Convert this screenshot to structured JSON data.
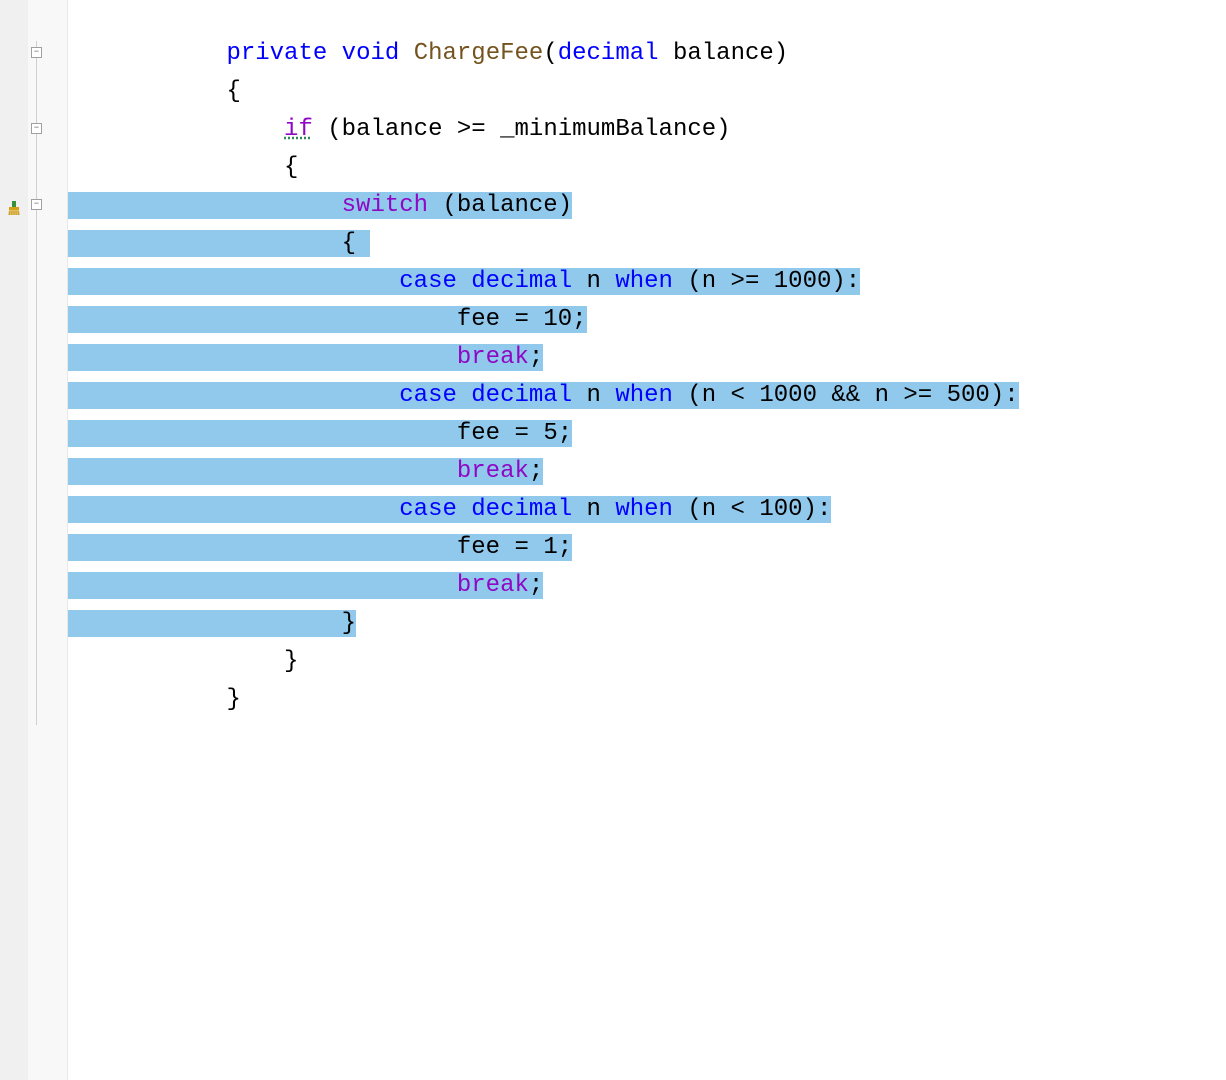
{
  "editor": {
    "lines": [
      {
        "indent": 2,
        "tokens": [
          {
            "t": "private",
            "c": "kw"
          },
          {
            "t": " ",
            "c": "op"
          },
          {
            "t": "void",
            "c": "kw"
          },
          {
            "t": " ",
            "c": "op"
          },
          {
            "t": "ChargeFee",
            "c": "method"
          },
          {
            "t": "(",
            "c": "op"
          },
          {
            "t": "decimal",
            "c": "kw"
          },
          {
            "t": " ",
            "c": "op"
          },
          {
            "t": "balance",
            "c": "ident"
          },
          {
            "t": ")",
            "c": "op"
          }
        ],
        "sel": false
      },
      {
        "indent": 2,
        "tokens": [
          {
            "t": "{",
            "c": "op"
          }
        ],
        "sel": false
      },
      {
        "indent": 3,
        "tokens": [
          {
            "t": "if",
            "c": "ctrl if-underline"
          },
          {
            "t": " (",
            "c": "op"
          },
          {
            "t": "balance",
            "c": "ident"
          },
          {
            "t": " >= ",
            "c": "op"
          },
          {
            "t": "_minimumBalance",
            "c": "ident"
          },
          {
            "t": ")",
            "c": "op"
          }
        ],
        "sel": false
      },
      {
        "indent": 3,
        "tokens": [
          {
            "t": "{",
            "c": "op"
          }
        ],
        "sel": false
      },
      {
        "indent": 4,
        "tokens": [
          {
            "t": "switch",
            "c": "ctrl"
          },
          {
            "t": " (",
            "c": "op"
          },
          {
            "t": "balance",
            "c": "ident"
          },
          {
            "t": ")",
            "c": "op"
          }
        ],
        "sel": true,
        "selFrom": 0
      },
      {
        "indent": 4,
        "tokens": [
          {
            "t": "{",
            "c": "op"
          },
          {
            "t": " ",
            "c": "op"
          }
        ],
        "sel": true,
        "selFrom": 0
      },
      {
        "indent": 5,
        "tokens": [
          {
            "t": "case",
            "c": "kw"
          },
          {
            "t": " ",
            "c": "op"
          },
          {
            "t": "decimal",
            "c": "kw"
          },
          {
            "t": " ",
            "c": "op"
          },
          {
            "t": "n",
            "c": "ident"
          },
          {
            "t": " ",
            "c": "op"
          },
          {
            "t": "when",
            "c": "kw"
          },
          {
            "t": " (",
            "c": "op"
          },
          {
            "t": "n",
            "c": "ident"
          },
          {
            "t": " >= ",
            "c": "op"
          },
          {
            "t": "1000",
            "c": "num"
          },
          {
            "t": "):",
            "c": "op"
          }
        ],
        "sel": true,
        "selFrom": 0
      },
      {
        "indent": 6,
        "tokens": [
          {
            "t": "fee",
            "c": "ident"
          },
          {
            "t": " = ",
            "c": "op"
          },
          {
            "t": "10",
            "c": "num"
          },
          {
            "t": ";",
            "c": "op"
          }
        ],
        "sel": true,
        "selFrom": 0
      },
      {
        "indent": 6,
        "tokens": [
          {
            "t": "break",
            "c": "ctrl"
          },
          {
            "t": ";",
            "c": "op"
          }
        ],
        "sel": true,
        "selFrom": 0
      },
      {
        "indent": 5,
        "tokens": [
          {
            "t": "case",
            "c": "kw"
          },
          {
            "t": " ",
            "c": "op"
          },
          {
            "t": "decimal",
            "c": "kw"
          },
          {
            "t": " ",
            "c": "op"
          },
          {
            "t": "n",
            "c": "ident"
          },
          {
            "t": " ",
            "c": "op"
          },
          {
            "t": "when",
            "c": "kw"
          },
          {
            "t": " (",
            "c": "op"
          },
          {
            "t": "n",
            "c": "ident"
          },
          {
            "t": " < ",
            "c": "op"
          },
          {
            "t": "1000",
            "c": "num"
          },
          {
            "t": " && ",
            "c": "op"
          },
          {
            "t": "n",
            "c": "ident"
          },
          {
            "t": " >= ",
            "c": "op"
          },
          {
            "t": "500",
            "c": "num"
          },
          {
            "t": "):",
            "c": "op"
          }
        ],
        "sel": true,
        "selFrom": 0
      },
      {
        "indent": 6,
        "tokens": [
          {
            "t": "fee",
            "c": "ident"
          },
          {
            "t": " = ",
            "c": "op"
          },
          {
            "t": "5",
            "c": "num"
          },
          {
            "t": ";",
            "c": "op"
          }
        ],
        "sel": true,
        "selFrom": 0
      },
      {
        "indent": 6,
        "tokens": [
          {
            "t": "break",
            "c": "ctrl"
          },
          {
            "t": ";",
            "c": "op"
          }
        ],
        "sel": true,
        "selFrom": 0
      },
      {
        "indent": 5,
        "tokens": [
          {
            "t": "case",
            "c": "kw"
          },
          {
            "t": " ",
            "c": "op"
          },
          {
            "t": "decimal",
            "c": "kw"
          },
          {
            "t": " ",
            "c": "op"
          },
          {
            "t": "n",
            "c": "ident"
          },
          {
            "t": " ",
            "c": "op"
          },
          {
            "t": "when",
            "c": "kw"
          },
          {
            "t": " (",
            "c": "op"
          },
          {
            "t": "n",
            "c": "ident"
          },
          {
            "t": " < ",
            "c": "op"
          },
          {
            "t": "100",
            "c": "num"
          },
          {
            "t": "):",
            "c": "op"
          }
        ],
        "sel": true,
        "selFrom": 0
      },
      {
        "indent": 6,
        "tokens": [
          {
            "t": "fee",
            "c": "ident"
          },
          {
            "t": " = ",
            "c": "op"
          },
          {
            "t": "1",
            "c": "num"
          },
          {
            "t": ";",
            "c": "op"
          }
        ],
        "sel": true,
        "selFrom": 0
      },
      {
        "indent": 6,
        "tokens": [
          {
            "t": "break",
            "c": "ctrl"
          },
          {
            "t": ";",
            "c": "op"
          }
        ],
        "sel": true,
        "selFrom": 0
      },
      {
        "indent": 4,
        "tokens": [
          {
            "t": "}",
            "c": "op"
          }
        ],
        "sel": true,
        "selFrom": 0,
        "selEndIndent": true
      },
      {
        "indent": 3,
        "tokens": [
          {
            "t": "}",
            "c": "op"
          }
        ],
        "sel": false
      },
      {
        "indent": 2,
        "tokens": [
          {
            "t": "}",
            "c": "op"
          }
        ],
        "sel": false
      }
    ],
    "indentUnit": "    ",
    "leadingPad": "   "
  },
  "outline": {
    "boxes": [
      {
        "line": 0,
        "glyph": "−"
      },
      {
        "line": 2,
        "glyph": "−"
      },
      {
        "line": 4,
        "glyph": "−",
        "marginIcon": true
      }
    ],
    "verticalLineFrom": 0,
    "verticalLineTo": 18
  }
}
